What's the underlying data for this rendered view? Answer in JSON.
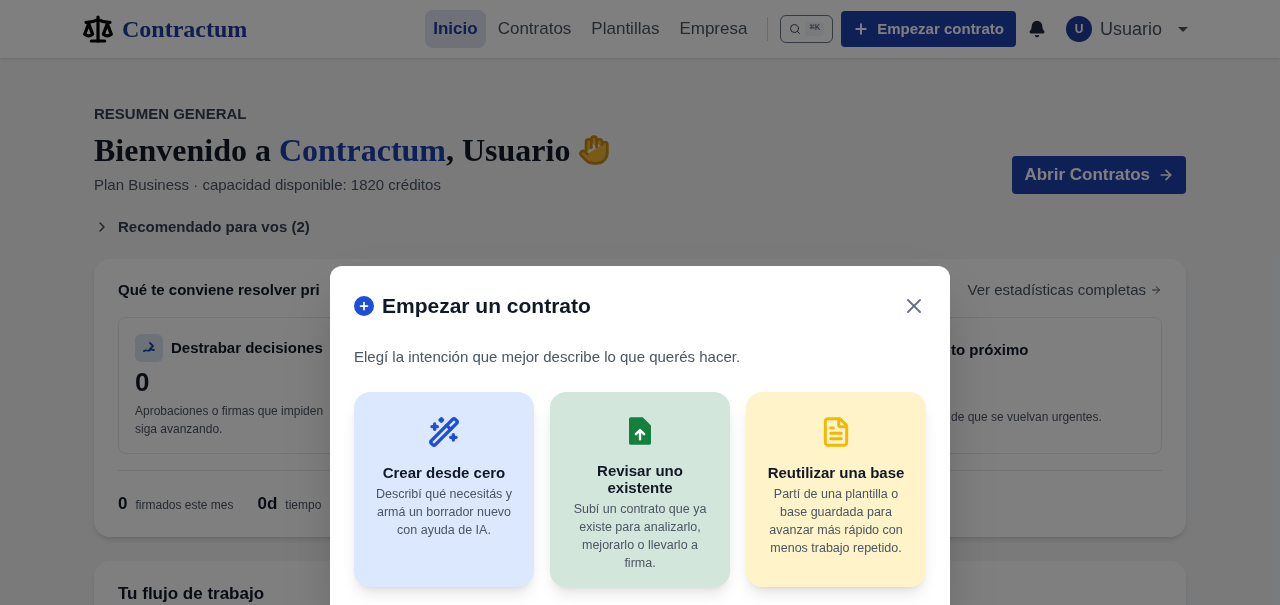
{
  "header": {
    "logo": "Contractum",
    "nav": [
      {
        "label": "Inicio",
        "selected": true
      },
      {
        "label": "Contratos",
        "selected": false
      },
      {
        "label": "Plantillas",
        "selected": false
      },
      {
        "label": "Empresa",
        "selected": false
      }
    ],
    "search_shortcut": "⌘K",
    "cta": "Empezar contrato",
    "avatar": "U",
    "user": "Usuario"
  },
  "overview": {
    "eyebrow": "RESUMEN GENERAL",
    "title_prefix": "Bienvenido a",
    "title_brand": "Contractum",
    "title_suffix": ", Usuario",
    "subtitle": "Plan Business · capacidad disponible: 1820 créditos",
    "open_button": "Abrir Contratos",
    "recommended": {
      "label": "Recomendado para vos (2)",
      "expanded": false
    }
  },
  "priority_card": {
    "title": "Qué te conviene resolver pri",
    "link": "Ver estadísticas completas",
    "left_stat": {
      "title": "Destrabar decisiones",
      "value": "0",
      "description_lines": [
        "Aprobaciones o firmas que impiden",
        "siga avanzando."
      ]
    },
    "right_stat": {
      "title": "to próximo",
      "description": "de que se vuelvan urgentes."
    },
    "bottom_stats": [
      {
        "value": "0",
        "label": "firmados este mes"
      },
      {
        "value": "0d",
        "label": "tiempo"
      }
    ]
  },
  "workflow_card": {
    "title": "Tu flujo de trabajo"
  },
  "dialog": {
    "title": "Empezar un contrato",
    "description": "Elegí la intención que mejor describe lo que querés hacer.",
    "options": [
      {
        "kind": "create",
        "title": "Crear desde cero",
        "description": "Describí qué necesitás y armá un borrador nuevo con ayuda de IA."
      },
      {
        "kind": "review",
        "title": "Revisar uno existente",
        "description": "Subí un contrato que ya existe para analizarlo, mejorarlo o llevarlo a firma."
      },
      {
        "kind": "reuse",
        "title": "Reutilizar una base",
        "description": "Partí de una plantilla o base guardada para avanzar más rápido con menos trabajo repetido."
      }
    ]
  }
}
